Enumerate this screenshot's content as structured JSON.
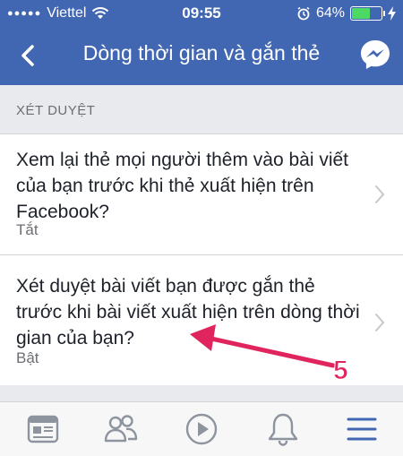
{
  "status_bar": {
    "signal_dots": "●●●●●",
    "carrier": "Viettel",
    "time": "09:55",
    "battery_percent": "64%",
    "battery_level": 0.64
  },
  "nav": {
    "title": "Dòng thời gian và gắn thẻ"
  },
  "section": {
    "header": "XÉT DUYỆT"
  },
  "settings": [
    {
      "title": "Xem lại thẻ mọi người thêm vào bài viết của bạn trước khi thẻ xuất hiện trên Facebook?",
      "value": "Tắt"
    },
    {
      "title": "Xét duyệt bài viết bạn được gắn thẻ trước khi bài viết xuất hiện trên dòng thời gian của bạn?",
      "value": "Bật"
    }
  ],
  "annotation": {
    "step": "5",
    "color": "#e0245e"
  },
  "colors": {
    "brand": "#4267b2",
    "tab_active": "#4267b2",
    "tab_inactive": "#8d949e"
  },
  "tabs": [
    "news-feed-icon",
    "friends-icon",
    "video-icon",
    "notifications-icon",
    "menu-icon"
  ]
}
